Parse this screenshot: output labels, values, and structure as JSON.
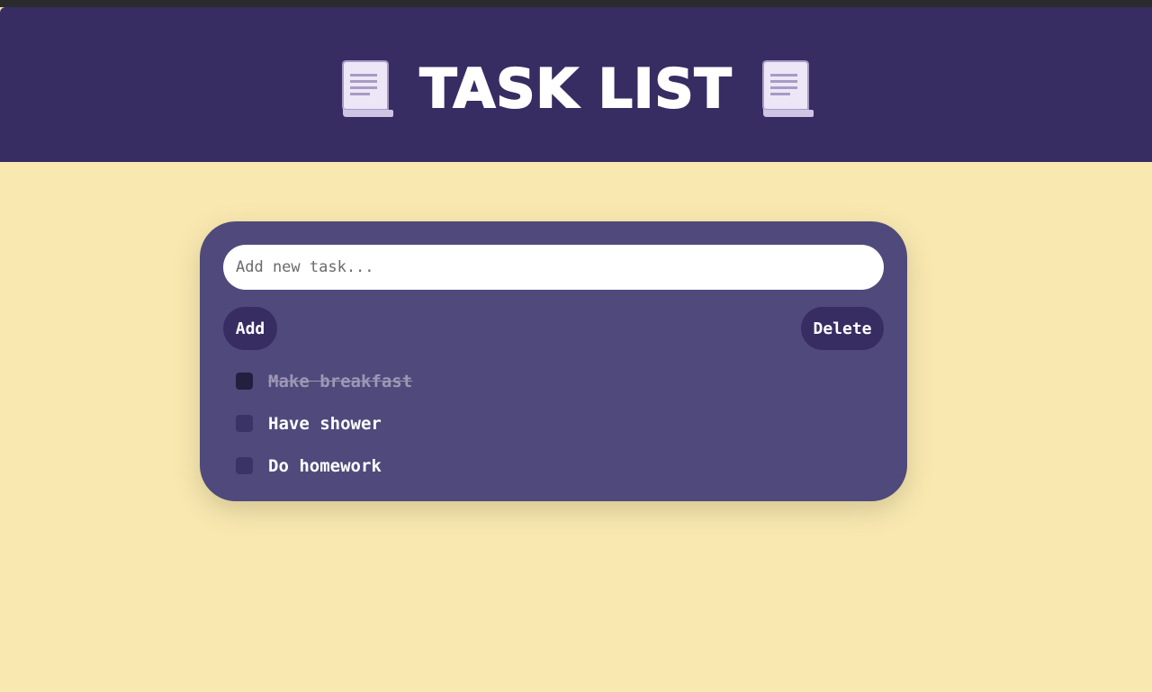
{
  "header": {
    "title": "TASK LIST",
    "left_icon": "scroll-icon",
    "right_icon": "scroll-icon"
  },
  "form": {
    "placeholder": "Add new task...",
    "add_label": "Add",
    "delete_label": "Delete"
  },
  "tasks": [
    {
      "label": "Make breakfast",
      "done": true
    },
    {
      "label": "Have shower",
      "done": false
    },
    {
      "label": "Do homework",
      "done": false
    }
  ],
  "colors": {
    "page_background": "#f9e9b1",
    "header_background": "#372d62",
    "card_background": "#4f4a7b",
    "button_background": "#372d62"
  }
}
